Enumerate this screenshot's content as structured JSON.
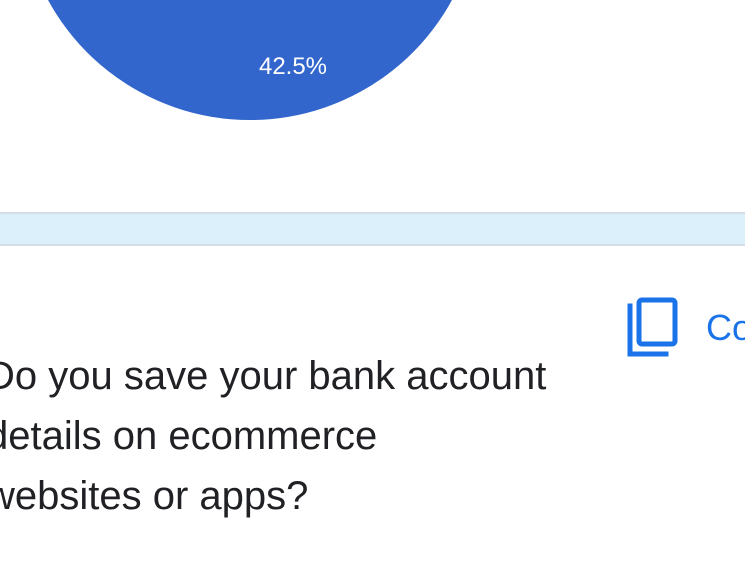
{
  "chart_data": {
    "type": "pie",
    "slices": [
      {
        "label": "",
        "value": 42.5,
        "value_label": "42.5%",
        "color": "#3366cc"
      }
    ]
  },
  "card": {
    "copy_label": "Copy",
    "question_text": "Do you save your bank account\ndetails on ecommerce\nwebsites or apps?"
  },
  "colors": {
    "accent": "#1a73e8",
    "divider_band": "#dcf0fc",
    "text": "#202124"
  },
  "icons": {
    "copy": "copy-icon"
  }
}
